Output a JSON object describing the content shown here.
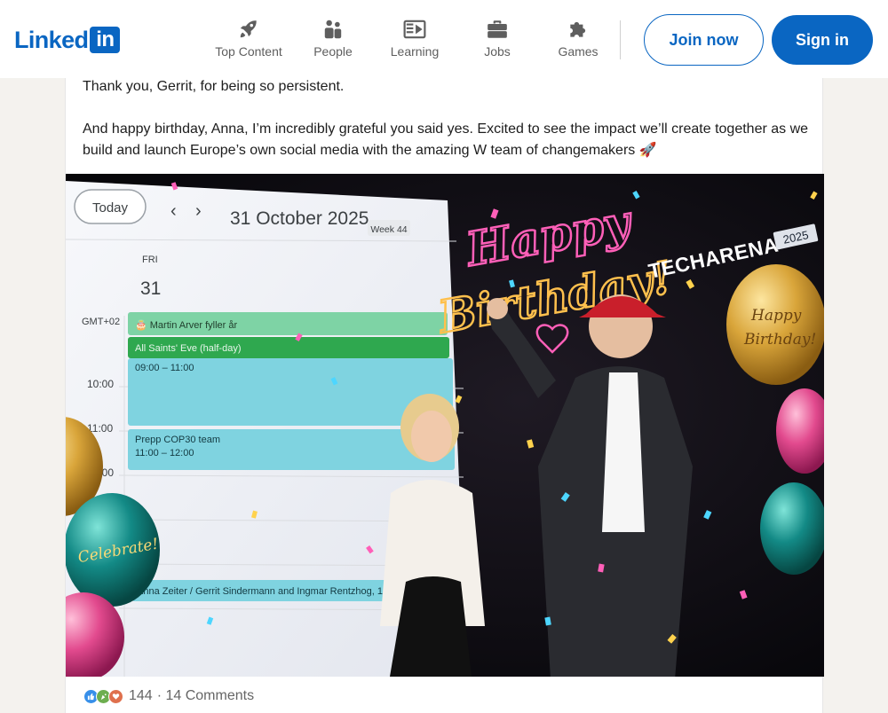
{
  "header": {
    "logo_text": "Linked",
    "logo_box_text": "in",
    "nav": [
      {
        "label": "Top Content",
        "icon": "rocket-icon"
      },
      {
        "label": "People",
        "icon": "people-icon"
      },
      {
        "label": "Learning",
        "icon": "learning-icon"
      },
      {
        "label": "Jobs",
        "icon": "briefcase-icon"
      },
      {
        "label": "Games",
        "icon": "puzzle-icon"
      }
    ],
    "join_label": "Join now",
    "sign_label": "Sign in"
  },
  "post": {
    "paragraph_1": "Thank you, Gerrit, for being so persistent.",
    "paragraph_2": "And happy birthday, Anna, I’m incredibly grateful you said yes. Excited to see the impact we’ll create together as we build and launch Europe’s own social media with the amazing W team of changemakers 🚀",
    "image": {
      "calendar_today": "Today",
      "calendar_nav_prev": "‹",
      "calendar_nav_next": "›",
      "calendar_date": "31 October 2025",
      "calendar_week": "Week 44",
      "day_name": "FRI",
      "day_number": "31",
      "timezone": "GMT+02",
      "times": [
        "10:00",
        "11:00",
        "12:00"
      ],
      "events": [
        {
          "title": "🎂 Martin Arver fyller år"
        },
        {
          "title": "All Saints' Eve (half-day)"
        },
        {
          "title": "09:00 – 11:00"
        },
        {
          "title": "Prepp COP30 team",
          "time": "11:00 – 12:00"
        },
        {
          "title": "Anna Zeiter / Gerrit Sindermann and Ingmar Rentzhog, 14:30"
        }
      ],
      "neon_line1": "Happy",
      "neon_line2": "Birthday!",
      "banner": "TECHARENA",
      "banner_year": "2025",
      "balloon_left": "Celebrate!",
      "balloon_right_1": "Happy",
      "balloon_right_2": "Birthday!"
    },
    "reactions_count": "144",
    "comments_text": "· 14 Comments",
    "colors": {
      "like": "#378fe9",
      "celebrate": "#6dae4f",
      "love": "#df704d"
    }
  },
  "colors": {
    "brand": "#0a66c2",
    "background": "#f4f2ee"
  }
}
